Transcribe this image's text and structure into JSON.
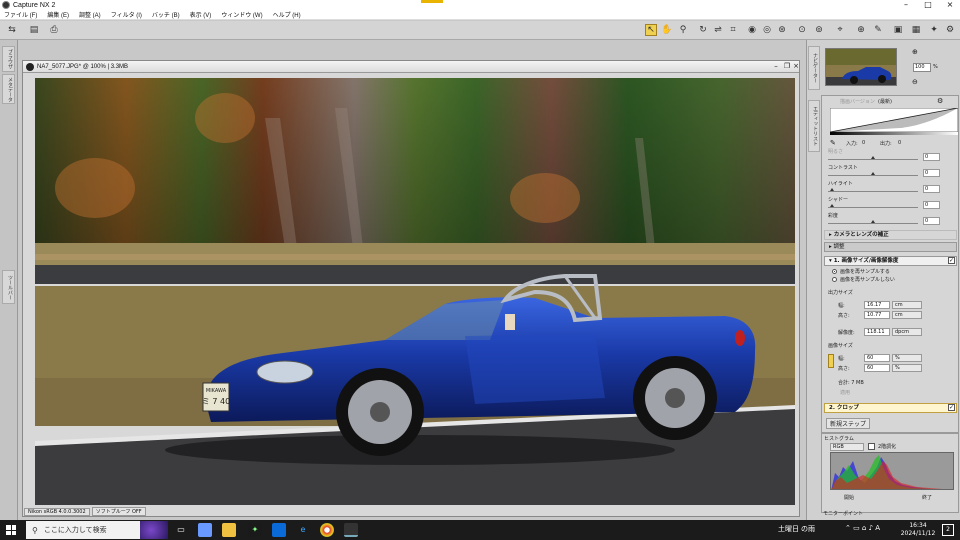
{
  "app": {
    "title": "Capture NX 2"
  },
  "menu": [
    "ファイル (F)",
    "編集 (E)",
    "調整 (A)",
    "フィルタ (I)",
    "バッチ (B)",
    "表示 (V)",
    "ウィンドウ (W)",
    "ヘルプ (H)"
  ],
  "left_tabs": [
    "ブラウザ",
    "メタデータ",
    "ツールバー"
  ],
  "document": {
    "title": "NA7_5077.JPG* @ 100% | 3.3MB",
    "status_profile": "Nikon sRGB 4.0.0.3002",
    "status_softproof": "ソフトプルーフ OFF"
  },
  "photo": {
    "plate_line1": "MIKAWA",
    "plate_line2": "ミ 7 40"
  },
  "navigator": {
    "tab_label": "ナビゲーター",
    "zoom": "100",
    "unit": "%",
    "zoom_in": "⊕",
    "zoom_out": "⊖"
  },
  "edit": {
    "tab_label": "エディットリスト",
    "curve_header": "描画バージョン",
    "curve_mode": "(最新)",
    "input_label": "入力:",
    "input_value": "0",
    "output_label": "出力:",
    "output_value": "0",
    "sliders": [
      {
        "label": "明るさ",
        "value": "0"
      },
      {
        "label": "コントラスト",
        "value": "0"
      },
      {
        "label": "ハイライト",
        "value": "0"
      },
      {
        "label": "シャドー",
        "value": "0"
      },
      {
        "label": "彩度",
        "value": "0"
      }
    ],
    "camera_section": "カメラとレンズの補正",
    "adjust_label": "調整",
    "resize_title": "1. 画像サイズ/画像解像度",
    "resample_on": "画像を再サンプルする",
    "resample_off": "画像を再サンプルしない",
    "output_size_label": "出力サイズ",
    "width_label": "幅:",
    "width_value": "16.17",
    "height_label": "高さ:",
    "height_value": "10.77",
    "cm_unit": "cm",
    "res_label": "解像度:",
    "res_value": "118.11",
    "res_unit": "dpcm",
    "image_size_label": "画像サイズ",
    "img_width_value": "60",
    "img_height_value": "60",
    "pct_unit": "%",
    "total_label": "合計: 7 MB",
    "apply_label": "適用",
    "crop_title": "2. クロップ",
    "new_step": "新規ステップ"
  },
  "histogram": {
    "title": "ヒストグラム",
    "channel": "RGB",
    "dual": "2階調化",
    "start_label": "開始",
    "end_label": "終了"
  },
  "bottom_panel": {
    "label": "モニターポイント"
  },
  "taskbar": {
    "search_placeholder": "ここに入力して検索",
    "weather": "土曜日 の雨",
    "time": "16:34",
    "date": "2024/11/12",
    "notifications": "2"
  },
  "colors": {
    "car_blue": "#1a3aa8",
    "accent_yellow": "#f0d050",
    "taskbar_bg": "#1b1b1b"
  }
}
